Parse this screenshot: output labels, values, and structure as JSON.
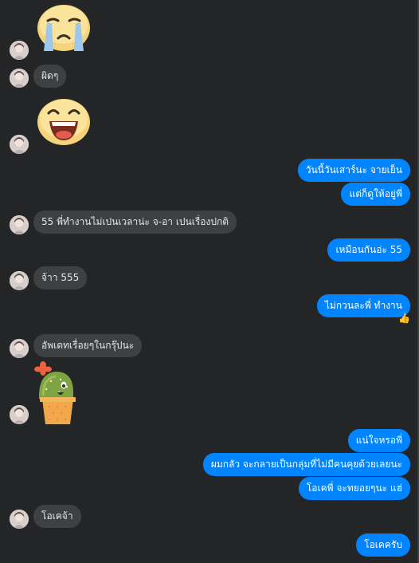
{
  "messages": [
    {
      "side": "in",
      "kind": "sticker",
      "sticker": "crying-face-sticker"
    },
    {
      "side": "in",
      "kind": "text",
      "text": "ผิดๆ"
    },
    {
      "side": "in",
      "kind": "sticker",
      "sticker": "laughing-face-sticker"
    },
    {
      "side": "out",
      "kind": "text",
      "text": "วันนี้วันเสาร์นะ จายเย็น"
    },
    {
      "side": "out",
      "kind": "text",
      "text": "แต่ก็ดูให้อยู่พี่"
    },
    {
      "side": "in",
      "kind": "text",
      "text": "55 พี่ทำงานไม่เปนเวลาน่ะ จ-อา เปนเรื่องปกติ"
    },
    {
      "side": "out",
      "kind": "text",
      "text": "เหมือนกันอ่ะ 55"
    },
    {
      "side": "in",
      "kind": "text",
      "text": "จ้าา 555"
    },
    {
      "side": "out",
      "kind": "text",
      "text": "ไม่กวนละพี่ ทำงาน",
      "reaction": "👍"
    },
    {
      "side": "in",
      "kind": "text",
      "text": "อัพเดทเรื่อยๆในกรุ๊ปนะ"
    },
    {
      "side": "in",
      "kind": "sticker",
      "sticker": "cactus-sticker"
    },
    {
      "side": "out",
      "kind": "text",
      "text": "แน่ใจหรอพี่"
    },
    {
      "side": "out",
      "kind": "text",
      "text": "ผมกลัว จะกลายเป็นกลุ่มที่ไม่มีคนคุยด้วยเลยนะ"
    },
    {
      "side": "out",
      "kind": "text",
      "text": "โอเคพี่ จะทยอยๆนะ แฮ่"
    },
    {
      "side": "in",
      "kind": "text",
      "text": "โอเคจ้า"
    },
    {
      "side": "out",
      "kind": "text",
      "text": "โอเคครับ"
    }
  ],
  "colors": {
    "background": "#242526",
    "incoming_bubble": "#3e4042",
    "outgoing_bubble": "#0084ff",
    "incoming_text": "#e4e6eb",
    "outgoing_text": "#ffffff"
  }
}
